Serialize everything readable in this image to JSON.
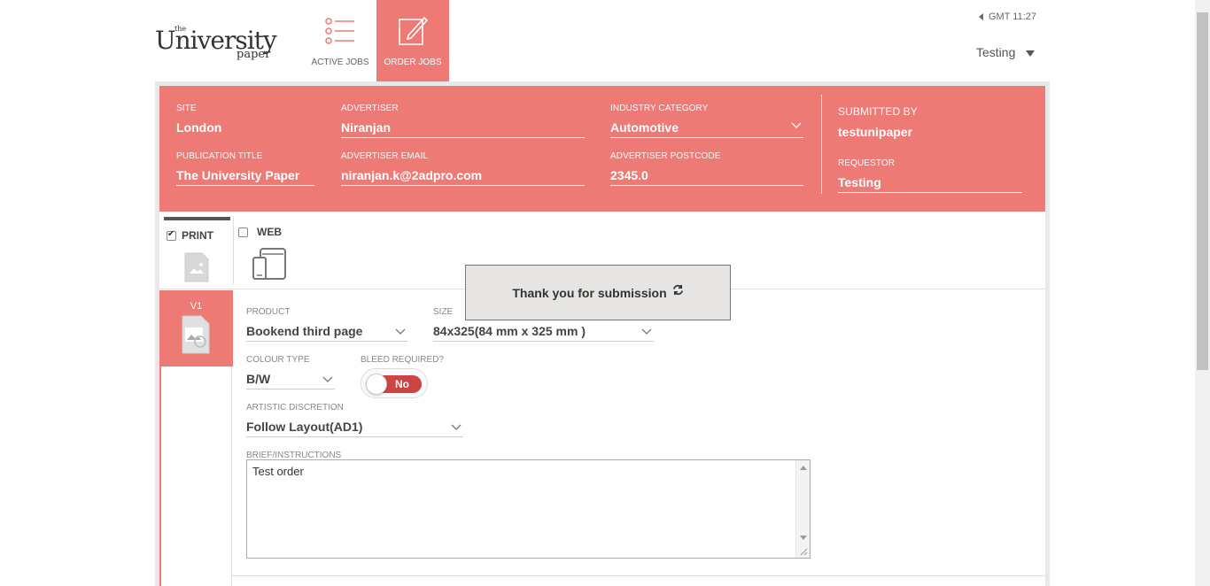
{
  "header": {
    "logo": {
      "the": "the",
      "name": "University",
      "sub": "paper"
    },
    "nav": [
      {
        "label": "ACTIVE JOBS",
        "icon": "list-icon",
        "active": false
      },
      {
        "label": "ORDER JOBS",
        "icon": "edit-icon",
        "active": true
      }
    ],
    "gmt": "GMT 11:27",
    "user": "Testing"
  },
  "order": {
    "site": {
      "label": "SITE",
      "value": "London"
    },
    "advertiser": {
      "label": "ADVERTISER",
      "value": "Niranjan"
    },
    "industry_category": {
      "label": "INDUSTRY CATEGORY",
      "value": "Automotive"
    },
    "submitted_by": {
      "label": "SUBMITTED BY",
      "value": "testunipaper"
    },
    "publication_title": {
      "label": "PUBLICATION TITLE",
      "value": "The University Paper"
    },
    "advertiser_email": {
      "label": "ADVERTISER EMAIL",
      "value": "niranjan.k@2adpro.com"
    },
    "advertiser_postcode": {
      "label": "ADVERTISER POSTCODE",
      "value": "2345.0"
    },
    "requestor": {
      "label": "REQUESTOR",
      "value": "Testing"
    }
  },
  "types": {
    "print": {
      "label": "PRINT",
      "checked": true
    },
    "web": {
      "label": "WEB",
      "checked": false
    }
  },
  "version": {
    "label": "V1"
  },
  "form": {
    "product": {
      "label": "PRODUCT",
      "value": "Bookend third page"
    },
    "size": {
      "label": "SIZE",
      "value": "84x325(84 mm x 325 mm )"
    },
    "colour_type": {
      "label": "COLOUR TYPE",
      "value": "B/W"
    },
    "bleed": {
      "label": "BLEED REQUIRED?",
      "value": "No",
      "on": false
    },
    "artistic": {
      "label": "ARTISTIC DISCRETION",
      "value": "Follow Layout(AD1)"
    },
    "brief": {
      "label": "BRIEF/INSTRUCTIONS",
      "value": "Test order"
    }
  },
  "toast": {
    "message": "Thank you for submission"
  },
  "colors": {
    "accent": "#ee7a76",
    "toggle_off": "#cc4444"
  }
}
